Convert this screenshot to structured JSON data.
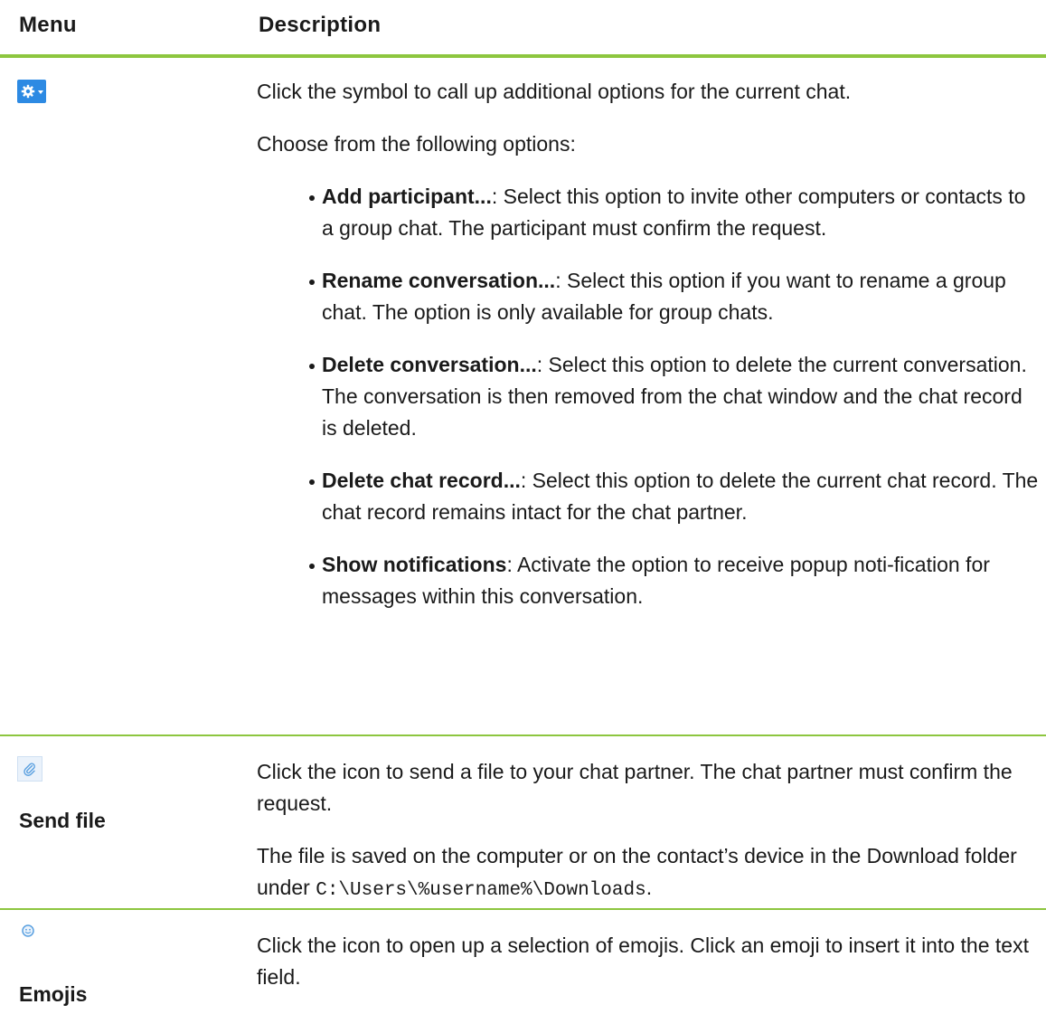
{
  "header": {
    "menu": "Menu",
    "description": "Description"
  },
  "rows": [
    {
      "menu_icon": "gear-dropdown-icon",
      "intro": "Click the symbol to call up additional options for the current chat.",
      "choose": "Choose from the following options:",
      "options": [
        {
          "title": "Add participant...",
          "text": ": Select this option to invite other computers or contacts to a group chat. The participant must confirm the request."
        },
        {
          "title": "Rename conversation...",
          "text": ": Select this option if you want to rename a group chat. The option is only available for group chats."
        },
        {
          "title": "Delete conversation...",
          "text": ": Select this option to delete the current conversation. The conversation is then removed from the chat window and the chat record is deleted."
        },
        {
          "title": "Delete chat record...",
          "text": ": Select this option to delete the current chat record. The chat record remains intact for the chat partner."
        },
        {
          "title": "Show notifications",
          "text": ": Activate the option to receive popup noti-fication for messages within this conversation."
        }
      ]
    },
    {
      "menu_icon": "paperclip-icon",
      "label": "Send file",
      "para1": "Click the icon to send a file to your chat partner. The chat partner must confirm the request.",
      "para2_prefix": "The file is saved on the computer or on the contact’s device in the Download folder under ",
      "para2_path": "C:\\Users\\%username%\\Downloads",
      "para2_suffix": "."
    },
    {
      "menu_icon": "smiley-icon",
      "label": "Emojis",
      "para1": "Click the icon to open up a selection of emojis. Click an emoji to insert it into the text field."
    }
  ],
  "colors": {
    "accent_rule": "#8dc63f",
    "button_blue": "#2d8ae3",
    "icon_blue": "#5aa0e0"
  }
}
